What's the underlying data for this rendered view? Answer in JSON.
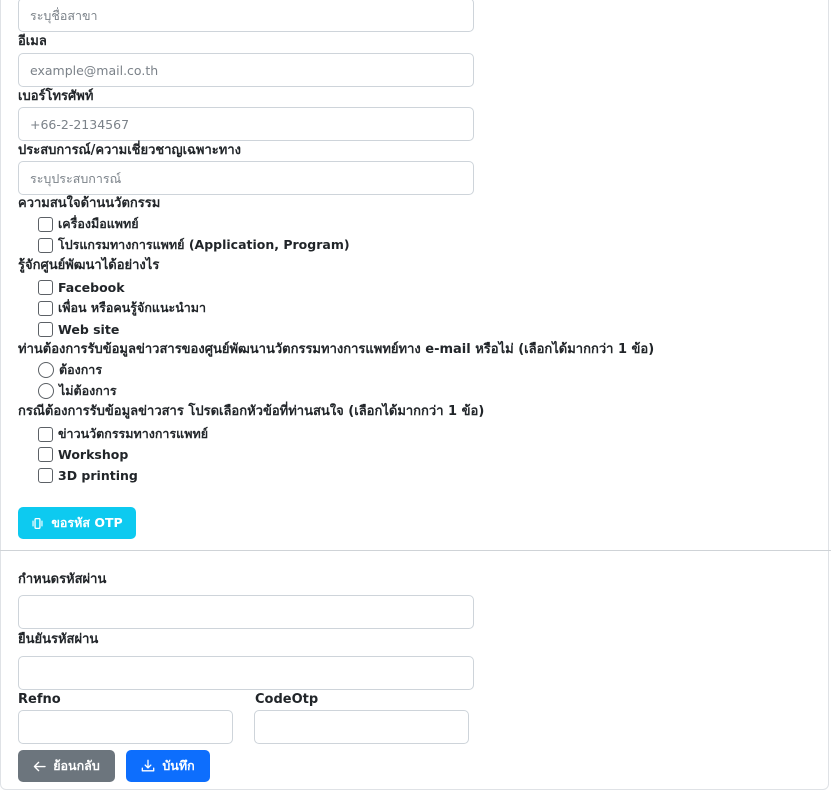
{
  "branch": {
    "placeholder": "ระบุชื่อสาขา"
  },
  "email": {
    "label": "อีเมล",
    "placeholder": "example@mail.co.th"
  },
  "phone": {
    "label": "เบอร์โทรศัพท์",
    "placeholder": "+66-2-2134567"
  },
  "experience": {
    "label": "ประสบการณ์/ความเชี่ยวชาญเฉพาะทาง",
    "placeholder": "ระบุประสบการณ์"
  },
  "innovation_interest": {
    "label": "ความสนใจด้านนวัตกรรม",
    "options": [
      {
        "label": "เครื่องมือแพทย์",
        "checked": false
      },
      {
        "label": "โปรแกรมทางการแพทย์ (Application, Program)",
        "checked": false
      }
    ]
  },
  "know_center": {
    "label": "รู้จักศูนย์พัฒนาได้อย่างไร",
    "options": [
      {
        "label": "Facebook",
        "checked": false
      },
      {
        "label": "เพื่อน หรือคนรู้จักแนะนำมา",
        "checked": false
      },
      {
        "label": "Web site",
        "checked": false
      }
    ]
  },
  "news_email": {
    "label": "ท่านต้องการรับข้อมูลข่าวสารของศูนย์พัฒนานวัตกรรมทางการแพทย์ทาง e-mail หรือไม่ (เลือกได้มากกว่า 1 ข้อ)",
    "options": [
      {
        "label": "ต้องการ",
        "selected": false
      },
      {
        "label": "ไม่ต้องการ",
        "selected": false
      }
    ]
  },
  "news_topics": {
    "label": "กรณีต้องการรับข้อมูลข่าวสาร โปรดเลือกหัวข้อที่ท่านสนใจ (เลือกได้มากกว่า 1 ข้อ)",
    "options": [
      {
        "label": "ข่าวนวัตกรรมทางการแพทย์",
        "checked": false
      },
      {
        "label": "Workshop",
        "checked": false
      },
      {
        "label": "3D printing",
        "checked": false
      }
    ]
  },
  "otp_button": {
    "label": "ขอรหัส OTP",
    "icon": "phone-vibrate-icon",
    "color": "#0dcaf0"
  },
  "password": {
    "label": "กำหนดรหัสผ่าน",
    "value": ""
  },
  "confirm_password": {
    "label": "ยืนยันรหัสผ่าน",
    "value": ""
  },
  "refno": {
    "label": "Refno",
    "value": ""
  },
  "codeotp": {
    "label": "CodeOtp",
    "value": ""
  },
  "back_button": {
    "label": "ย้อนกลับ",
    "icon": "arrow-left-icon",
    "color": "#6c757d"
  },
  "save_button": {
    "label": "บันทึก",
    "icon": "download-icon",
    "color": "#0d6efd"
  }
}
